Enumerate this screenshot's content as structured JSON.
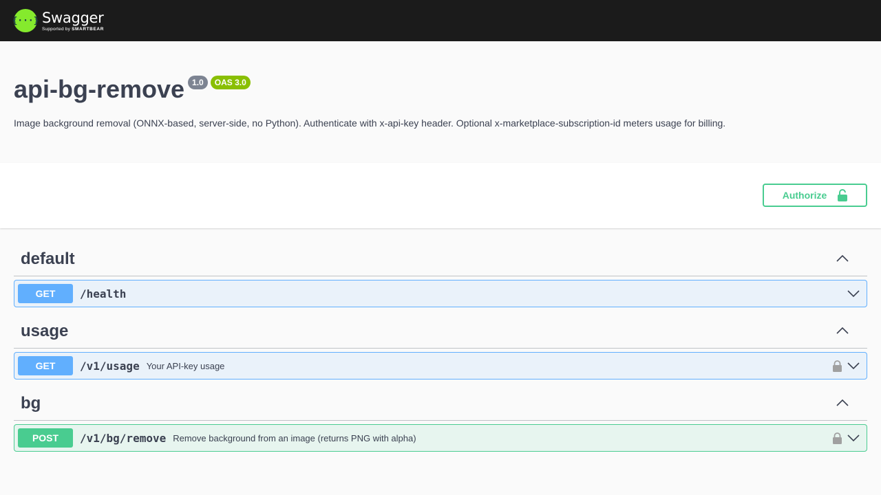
{
  "topbar": {
    "logo_mark": "{···}",
    "logo_name": "Swagger",
    "logo_sub_prefix": "Supported by ",
    "logo_sub_brand": "SMARTBEAR"
  },
  "info": {
    "title": "api-bg-remove",
    "version_badge": "1.0",
    "oas_badge": "OAS 3.0",
    "description": "Image background removal (ONNX-based, server-side, no Python). Authenticate with x-api-key header. Optional x-marketplace-subscription-id meters usage for billing."
  },
  "scheme": {
    "authorize_label": "Authorize",
    "authorize_icon": "unlock-icon"
  },
  "tags": [
    {
      "name": "default",
      "operations": [
        {
          "method": "GET",
          "path": "/health",
          "summary": "",
          "locked": false
        }
      ]
    },
    {
      "name": "usage",
      "operations": [
        {
          "method": "GET",
          "path": "/v1/usage",
          "summary": "Your API-key usage",
          "locked": true
        }
      ]
    },
    {
      "name": "bg",
      "operations": [
        {
          "method": "POST",
          "path": "/v1/bg/remove",
          "summary": "Remove background from an image (returns PNG with alpha)",
          "locked": true
        }
      ]
    }
  ],
  "colors": {
    "get": "#61affe",
    "post": "#49cc90",
    "authorize": "#49cc90",
    "topbar": "#1b1b1b",
    "logo": "#85ea2d"
  }
}
